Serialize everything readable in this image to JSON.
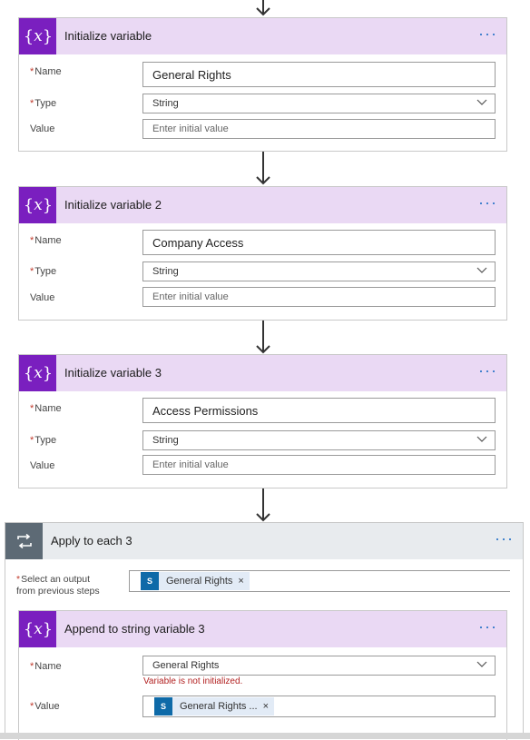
{
  "cards": [
    {
      "title": "Initialize variable",
      "name_label": "Name",
      "name_value": "General Rights",
      "type_label": "Type",
      "type_value": "String",
      "value_label": "Value",
      "value_placeholder": "Enter initial value"
    },
    {
      "title": "Initialize variable 2",
      "name_label": "Name",
      "name_value": "Company Access",
      "type_label": "Type",
      "type_value": "String",
      "value_label": "Value",
      "value_placeholder": "Enter initial value"
    },
    {
      "title": "Initialize variable 3",
      "name_label": "Name",
      "name_value": "Access Permissions",
      "type_label": "Type",
      "type_value": "String",
      "value_label": "Value",
      "value_placeholder": "Enter initial value"
    }
  ],
  "apply": {
    "title": "Apply to each 3",
    "select_label_line1": "Select an output",
    "select_label_line2": "from previous steps",
    "token": "General Rights",
    "token_remove": "×"
  },
  "append": {
    "title": "Append to string variable 3",
    "name_label": "Name",
    "name_value": "General Rights",
    "error": "Variable is not initialized.",
    "value_label": "Value",
    "token": "General Rights ...",
    "token_remove": "×"
  },
  "common": {
    "required_mark": "*",
    "more_glyph": "···",
    "var_icon_glyph": "x",
    "sp_icon_glyph": "S"
  },
  "colors": {
    "variable_accent": "#7a1fbf",
    "variable_header": "#ead9f4",
    "loop_accent": "#5d6a75",
    "loop_header": "#e8ebee",
    "link_blue": "#2b74c8",
    "error_red": "#b22222"
  },
  "icons": [
    "variable-icon",
    "more-options-icon",
    "chevron-down-icon",
    "arrow-down-icon",
    "loop-icon",
    "sharepoint-icon",
    "remove-token-icon"
  ]
}
